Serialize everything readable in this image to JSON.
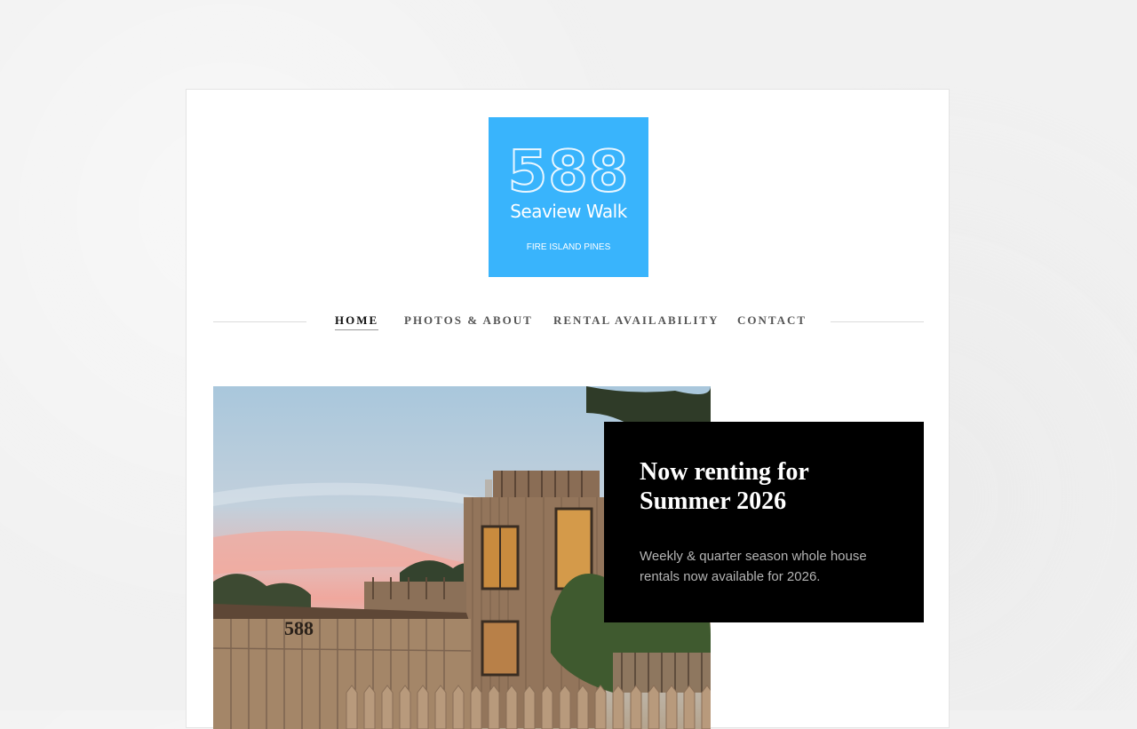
{
  "logo": {
    "number": "588",
    "name": "Seaview Walk",
    "location": "FIRE ISLAND PINES",
    "background": "#39b4fc"
  },
  "nav": {
    "items": [
      {
        "label": "HOME",
        "active": true
      },
      {
        "label": "PHOTOS & ABOUT",
        "active": false
      },
      {
        "label": "RENTAL AVAILABILITY",
        "active": false
      },
      {
        "label": "CONTACT",
        "active": false
      }
    ]
  },
  "hero": {
    "house_number": "588"
  },
  "promo": {
    "title_line1": "Now renting for",
    "title_line2": "Summer 2026",
    "text_line1": "Weekly & quarter season whole house",
    "text_line2": "rentals now available for 2026."
  }
}
